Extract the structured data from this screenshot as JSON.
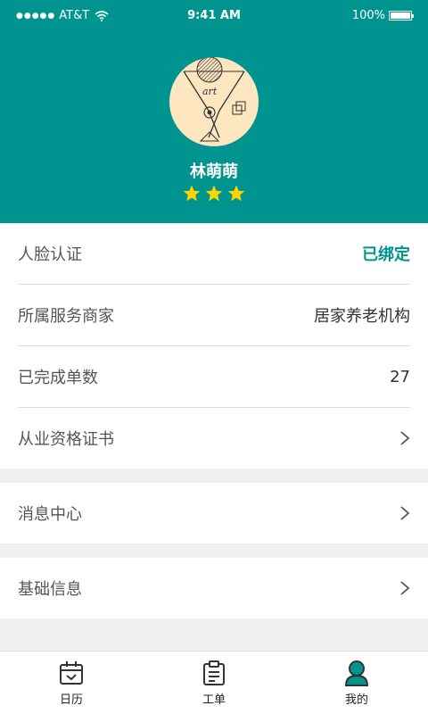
{
  "status_bar": {
    "carrier": "AT&T",
    "time": "9:41 AM",
    "battery": "100%",
    "battery_level": 1.0
  },
  "profile": {
    "name": "林萌萌",
    "rating": 3,
    "avatar_text": "art",
    "colors": {
      "header_bg": "#009490",
      "star": "#ffd400"
    }
  },
  "info_list": [
    {
      "label": "人脸认证",
      "value": "已绑定",
      "accent": true
    },
    {
      "label": "所属服务商家",
      "value": "居家养老机构"
    },
    {
      "label": "已完成单数",
      "value": "27"
    },
    {
      "label": "从业资格证书",
      "value": ""
    }
  ],
  "menu_items": [
    {
      "label": "消息中心"
    },
    {
      "label": "基础信息"
    }
  ],
  "tabbar": {
    "tabs": [
      {
        "label": "日历",
        "icon": "calendar-icon"
      },
      {
        "label": "工单",
        "icon": "clipboard-icon"
      },
      {
        "label": "我的",
        "icon": "user-icon",
        "active": true
      }
    ]
  }
}
